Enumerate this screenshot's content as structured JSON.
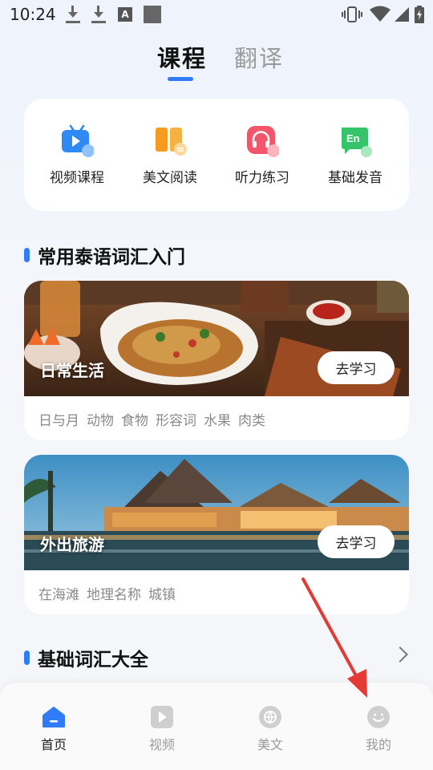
{
  "status_bar": {
    "time": "10:24",
    "a_badge": "A"
  },
  "tabs": [
    {
      "label": "课程",
      "active": true
    },
    {
      "label": "翻译",
      "active": false
    }
  ],
  "categories": [
    {
      "label": "视频课程",
      "icon": "tv-icon",
      "color": "#2f8af5"
    },
    {
      "label": "美文阅读",
      "icon": "book-icon",
      "color": "#f59b20"
    },
    {
      "label": "听力练习",
      "icon": "headphones-icon",
      "color": "#f2566b"
    },
    {
      "label": "基础发音",
      "icon": "en-chat-icon",
      "color": "#35c46a"
    }
  ],
  "section_vocab_intro": {
    "title": "常用泰语词汇入门"
  },
  "courses": [
    {
      "title": "日常生活",
      "button": "去学习",
      "tags": [
        "日与月",
        "动物",
        "食物",
        "形容词",
        "水果",
        "肉类"
      ]
    },
    {
      "title": "外出旅游",
      "button": "去学习",
      "tags": [
        "在海滩",
        "地理名称",
        "城镇"
      ]
    }
  ],
  "section_basic": {
    "title": "基础词汇大全"
  },
  "bottom_nav": [
    {
      "label": "首页",
      "icon": "home-icon",
      "active": true
    },
    {
      "label": "视频",
      "icon": "video-play-icon",
      "active": false
    },
    {
      "label": "美文",
      "icon": "globe-chat-icon",
      "active": false
    },
    {
      "label": "我的",
      "icon": "smiley-profile-icon",
      "active": false
    }
  ],
  "colors": {
    "accent": "#2f7cf6",
    "arrow": "#e53935"
  }
}
